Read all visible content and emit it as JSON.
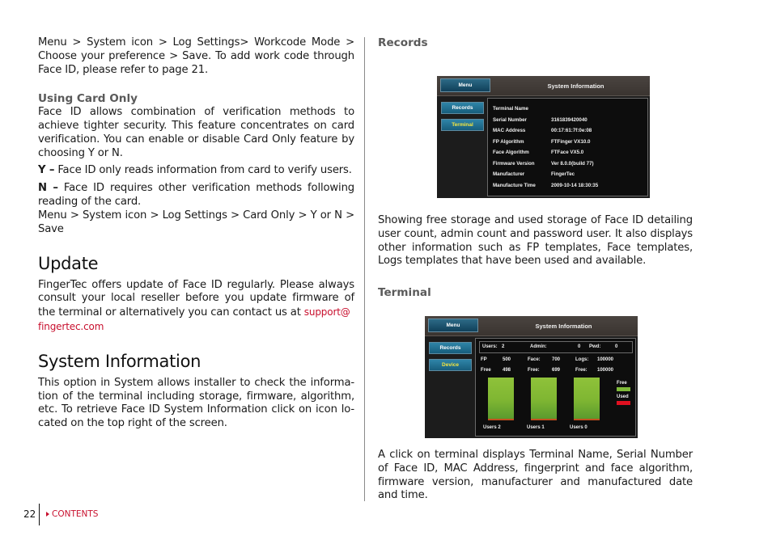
{
  "left": {
    "intro_paragraph": "Menu > System icon > Log Settings> Workcode Mode > Choose your preference > Save. To add work code through Face ID, please refer to page 21.",
    "card_only": {
      "heading": "Using Card Only",
      "paragraph": "Face ID allows combination of verification methods to achieve tighter security. This feature concentrates on card verification. You can enable or disable Card Only feature by choosing Y or N.",
      "y_term": "Y –",
      "y_text": " Face ID only reads information from card to verify users.",
      "n_term": "N –",
      "n_text": " Face ID requires other verification methods following reading of the card.",
      "path": "Menu > System icon > Log Settings > Card Only > Y or N > Save"
    },
    "update": {
      "heading": "Update",
      "paragraph": "FingerTec offers update of Face ID regularly. Please always consult your local reseller before you update firmware of the terminal or alternatively you can contact us at ",
      "email_line1": "support@",
      "email_line2": "fingertec.com"
    },
    "system_information": {
      "heading": "System Information",
      "paragraph": "This option in System allows installer to check the informa-tion of the terminal including storage, firmware, algorithm, etc. To retrieve Face ID System Information click on icon lo-cated on the top right of the screen."
    }
  },
  "right": {
    "records": {
      "heading": "Records",
      "paragraph": "Showing free storage and used storage of Face ID detailing user count, admin count and password user. It also displays other information such as FP templates, Face templates, Logs templates that have been used and available."
    },
    "terminal": {
      "heading": "Terminal",
      "paragraph": "A click on terminal displays Terminal Name, Serial Number of Face ID, MAC Address, fingerprint and face algorithm, firmware version, manufacturer and manufactured date and time."
    }
  },
  "screen_terminal": {
    "menu_label": "Menu",
    "title": "System Information",
    "side_buttons": [
      "Records",
      "Terminal"
    ],
    "rows": [
      {
        "label": "Terminal Name",
        "value": ""
      },
      {
        "label": "Serial Number",
        "value": "3161839420040"
      },
      {
        "label": "MAC Address",
        "value": "00:17:61:7f:0e:08"
      },
      {
        "label": "FP Algorithm",
        "value": "FTFinger VX10.0"
      },
      {
        "label": "Face Algorithm",
        "value": "FTFace VX5.0"
      },
      {
        "label": "Firmware Version",
        "value": "Ver 8.0.0(build 77)"
      },
      {
        "label": "Manufacturer",
        "value": "FingerTec"
      },
      {
        "label": "Manufacture Time",
        "value": "2009-10-14  18:30:35"
      }
    ]
  },
  "screen_records": {
    "menu_label": "Menu",
    "title": "System Information",
    "side_buttons": [
      "Records",
      "Device"
    ],
    "users_label": "Users:",
    "users_value": "2",
    "admin_label": "Admin:",
    "admin_value": "0",
    "pwd_label": "Pwd:",
    "pwd_value": "0",
    "fp_label": "FP",
    "fp_value": "500",
    "face_label": "Face:",
    "face_value": "700",
    "logs_label": "Logs:",
    "logs_value": "100000",
    "fp_free_label": "Free",
    "fp_free_value": "498",
    "face_free_label": "Free:",
    "face_free_value": "699",
    "logs_free_label": "Free:",
    "logs_free_value": "100000",
    "bar_captions": [
      "Users 2",
      "Users 1",
      "Users 0"
    ],
    "legend_free": "Free",
    "legend_used": "Used",
    "colors": {
      "free": "#7fba3a",
      "used": "#e01020"
    }
  },
  "footer": {
    "page_number": "22",
    "contents_link": "CONTENTS",
    "link_color": "#c8102e"
  }
}
